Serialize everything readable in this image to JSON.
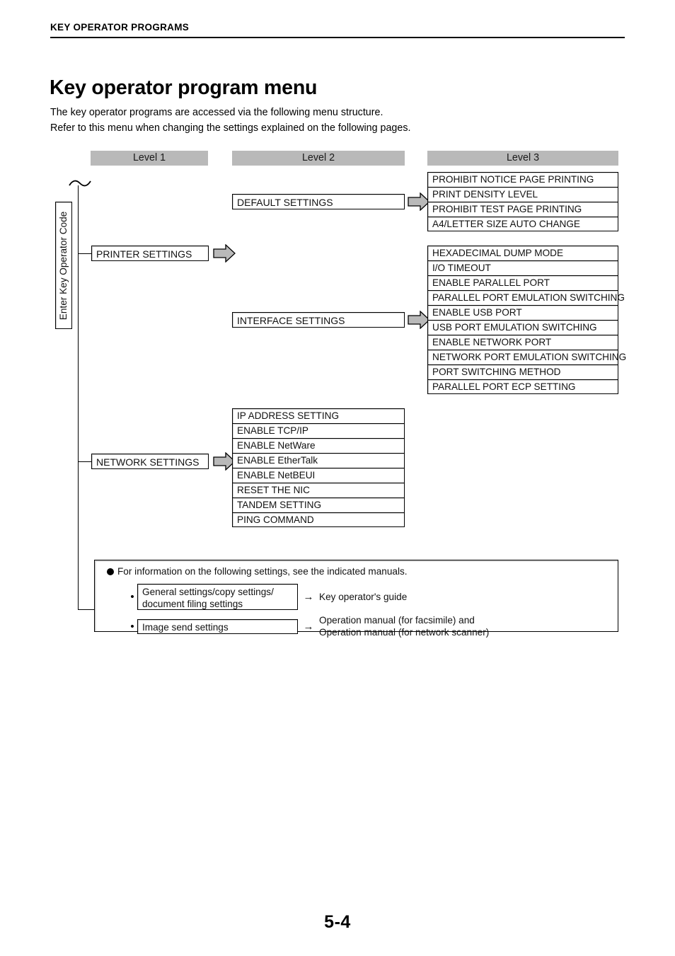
{
  "header": {
    "running_head": "KEY OPERATOR PROGRAMS"
  },
  "title": "Key operator program menu",
  "intro": {
    "line1": "The key operator programs are accessed via the following menu structure.",
    "line2": "Refer to this menu when changing the settings explained on the following pages."
  },
  "columns": {
    "level1": "Level 1",
    "level2": "Level 2",
    "level3": "Level 3"
  },
  "entry": {
    "label": "Enter Key Operator Code"
  },
  "level1": {
    "printer_settings": "PRINTER SETTINGS",
    "network_settings": "NETWORK SETTINGS"
  },
  "level2": {
    "default_settings": "DEFAULT SETTINGS",
    "interface_settings": "INTERFACE SETTINGS",
    "network_items": [
      "IP ADDRESS SETTING",
      "ENABLE TCP/IP",
      "ENABLE NetWare",
      "ENABLE EtherTalk",
      "ENABLE NetBEUI",
      "RESET THE NIC",
      "TANDEM SETTING",
      "PING COMMAND"
    ]
  },
  "level3": {
    "default_settings_items": [
      "PROHIBIT NOTICE PAGE PRINTING",
      "PRINT DENSITY LEVEL",
      "PROHIBIT TEST PAGE PRINTING",
      "A4/LETTER SIZE AUTO CHANGE"
    ],
    "interface_settings_items": [
      "HEXADECIMAL DUMP MODE",
      "I/O TIMEOUT",
      "ENABLE PARALLEL PORT",
      "PARALLEL PORT EMULATION SWITCHING",
      "ENABLE USB PORT",
      "USB PORT EMULATION SWITCHING",
      "ENABLE NETWORK PORT",
      "NETWORK PORT EMULATION SWITCHING",
      "PORT SWITCHING METHOD",
      "PARALLEL PORT ECP SETTING"
    ]
  },
  "note": {
    "heading": "For information on the following settings, see the indicated manuals.",
    "bullet": "•",
    "arrow": "→",
    "rows": [
      {
        "box_line1": "General settings/copy settings/",
        "box_line2": "document filing settings",
        "target_line1": "Key operator's guide",
        "target_line2": ""
      },
      {
        "box_line1": "Image send settings",
        "box_line2": "",
        "target_line1": "Operation manual (for facsimile) and",
        "target_line2": "Operation manual (for network scanner)"
      }
    ]
  },
  "footer": {
    "page_number": "5-4"
  },
  "colors": {
    "header_band": "#b9b9b9",
    "arrow_fill": "#b9b9b9",
    "outline": "#000000"
  }
}
